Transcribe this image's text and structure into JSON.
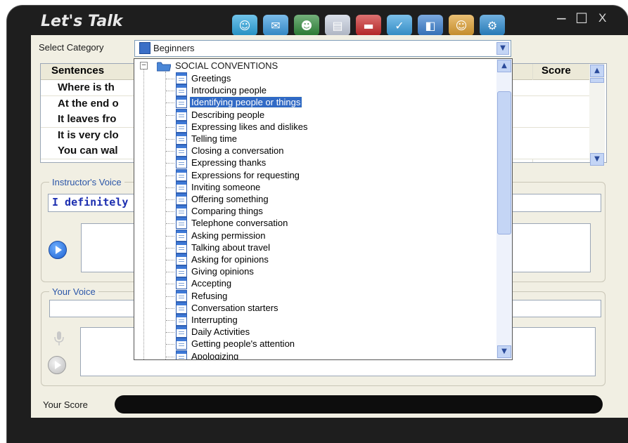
{
  "window": {
    "title": "Let's Talk",
    "controls": [
      "−",
      "☐",
      "X"
    ]
  },
  "toolbar": [
    {
      "icon": "chat-bubble-icon",
      "color": "#2aa6e0"
    },
    {
      "icon": "envelope-icon",
      "color": "#3a9be0"
    },
    {
      "icon": "people-icon",
      "color": "#2f8a3a"
    },
    {
      "icon": "notepad-icon",
      "color": "#c8d0e0"
    },
    {
      "icon": "book-icon",
      "color": "#cc2a2a"
    },
    {
      "icon": "abc-check-icon",
      "color": "#3aa0e0"
    },
    {
      "icon": "projector-icon",
      "color": "#3a7fd0"
    },
    {
      "icon": "teacher-icon",
      "color": "#e0a030"
    },
    {
      "icon": "settings-gear-icon",
      "color": "#2a8ad0"
    }
  ],
  "category": {
    "label": "Select Category",
    "selected": "Beginners"
  },
  "table": {
    "col_sentences": "Sentences",
    "col_score": "Score",
    "rows": [
      "Where is th",
      "At the end o",
      "It leaves fro",
      "It is very clo",
      "You can wal"
    ]
  },
  "instructor": {
    "label": "Instructor's Voice",
    "text": "I definitely th"
  },
  "your_voice": {
    "label": "Your Voice"
  },
  "score": {
    "label": "Your Score"
  },
  "dropdown": {
    "root": "SOCIAL CONVENTIONS",
    "selected_index": 2,
    "items": [
      "Greetings",
      "Introducing people",
      "Identifying people or things",
      "Describing people",
      "Expressing likes and dislikes",
      "Telling time",
      "Closing a conversation",
      "Expressing thanks",
      "Expressions for requesting",
      "Inviting someone",
      "Offering something",
      "Comparing things",
      "Telephone conversation",
      "Asking permission",
      "Talking about travel",
      "Asking for opinions",
      "Giving opinions",
      "Accepting",
      "Refusing",
      "Conversation starters",
      "Interrupting",
      "Daily Activities",
      "Getting people's attention",
      "Apologizing"
    ]
  },
  "colors": {
    "accent": "#316ac5",
    "frame": "#1e1e1e",
    "group_title": "#2b56a8",
    "instructor_text": "#1d2fb0"
  }
}
